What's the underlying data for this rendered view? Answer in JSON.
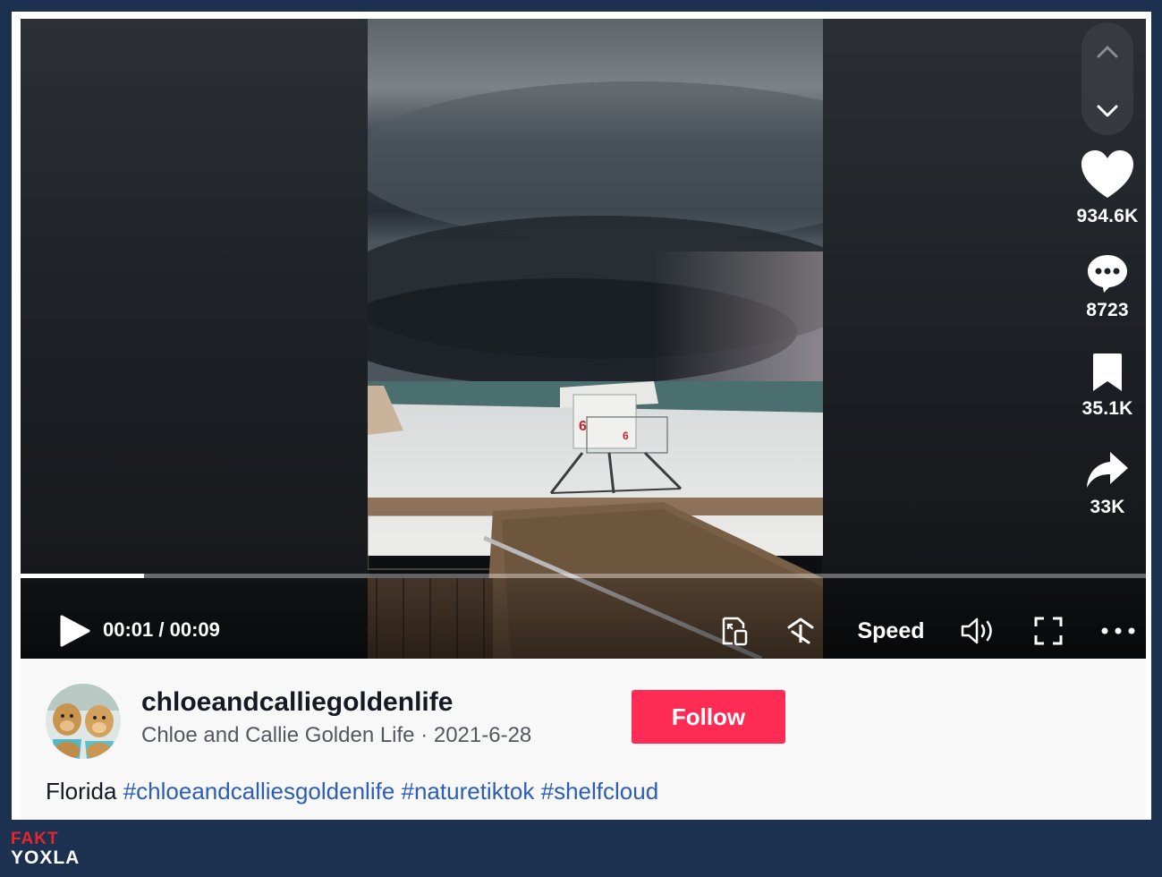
{
  "video": {
    "time_current": "00:01",
    "time_sep": " / ",
    "time_total": "00:09",
    "progress": 0.11,
    "speed_label": "Speed"
  },
  "actions": {
    "likes": "934.6K",
    "comments": "8723",
    "saves": "35.1K",
    "shares": "33K"
  },
  "author": {
    "username": "chloeandcalliegoldenlife",
    "display_name": "Chloe and Callie Golden Life",
    "separator": " · ",
    "date": "2021-6-28",
    "follow_label": "Follow"
  },
  "caption": {
    "text": "Florida",
    "hashtags": [
      "#chloeandcalliesgoldenlife",
      "#naturetiktok",
      "#shelfcloud"
    ]
  },
  "watermark": {
    "line1": "FAKT",
    "line2": "YOXLA"
  },
  "colors": {
    "page_bg": "#1c3150",
    "follow_button": "#fe2c55",
    "hashtag": "#2b5db9",
    "logo_red": "#e5262d"
  },
  "icons": [
    "chevron-up-icon",
    "chevron-down-icon",
    "heart-icon",
    "comment-icon",
    "bookmark-icon",
    "share-icon",
    "play-icon",
    "picture-in-picture-icon",
    "floating-player-icon",
    "volume-icon",
    "fullscreen-icon",
    "more-icon"
  ]
}
